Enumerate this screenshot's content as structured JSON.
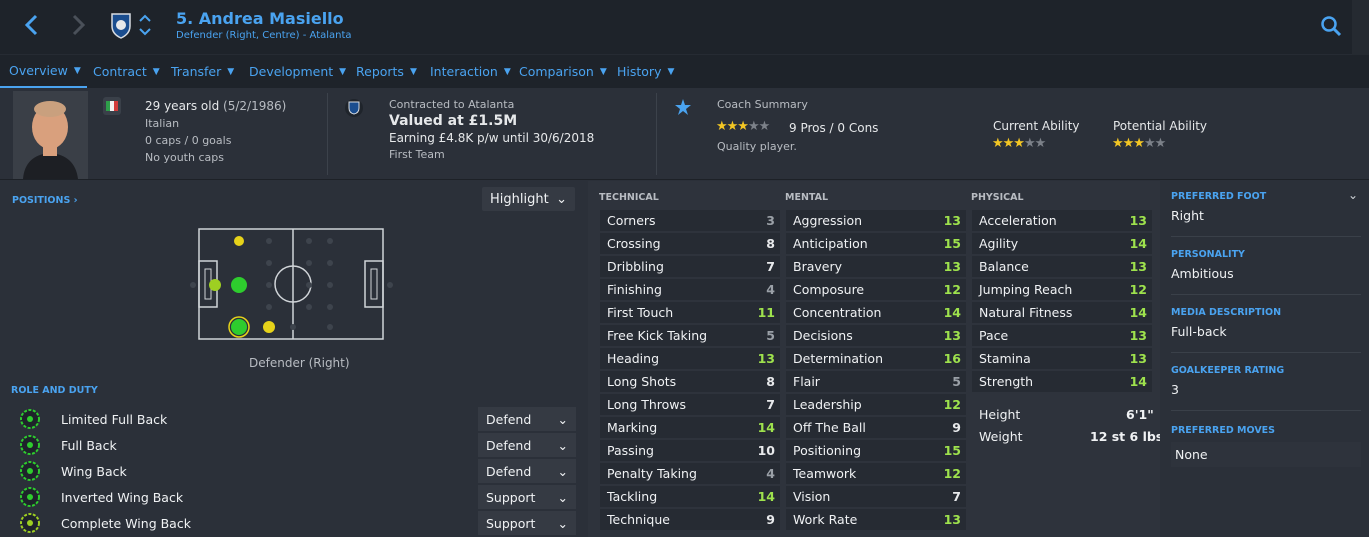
{
  "header": {
    "title": "5. Andrea Masiello",
    "subtitle": "Defender (Right, Centre) - Atalanta"
  },
  "tabs": [
    "Overview",
    "Contract",
    "Transfer",
    "Development",
    "Reports",
    "Interaction",
    "Comparison",
    "History"
  ],
  "summary": {
    "age": "29 years old",
    "dob": "(5/2/1986)",
    "nationality": "Italian",
    "caps": "0 caps / 0 goals",
    "youth": "No youth caps",
    "contracted": "Contracted to Atalanta",
    "value": "Valued at £1.5M",
    "earning": "Earning £4.8K p/w until 30/6/2018",
    "squad": "First Team",
    "coach_title": "Coach Summary",
    "pros_cons": "9 Pros / 0 Cons",
    "quality": "Quality player.",
    "coach_stars": 3,
    "current_ability_label": "Current Ability",
    "potential_ability_label": "Potential Ability",
    "current_stars": 3,
    "potential_stars": 3
  },
  "positions": {
    "label": "POSITIONS",
    "highlight": "Highlight",
    "caption": "Defender (Right)"
  },
  "role_duty": {
    "label": "ROLE AND DUTY",
    "roles": [
      {
        "name": "Limited Full Back",
        "duty": "Defend"
      },
      {
        "name": "Full Back",
        "duty": "Defend"
      },
      {
        "name": "Wing Back",
        "duty": "Defend"
      },
      {
        "name": "Inverted Wing Back",
        "duty": "Support"
      },
      {
        "name": "Complete Wing Back",
        "duty": "Support"
      }
    ]
  },
  "attributes": {
    "technical_label": "TECHNICAL",
    "mental_label": "MENTAL",
    "physical_label": "PHYSICAL",
    "technical": [
      {
        "name": "Corners",
        "value": "3"
      },
      {
        "name": "Crossing",
        "value": "8"
      },
      {
        "name": "Dribbling",
        "value": "7"
      },
      {
        "name": "Finishing",
        "value": "4"
      },
      {
        "name": "First Touch",
        "value": "11"
      },
      {
        "name": "Free Kick Taking",
        "value": "5"
      },
      {
        "name": "Heading",
        "value": "13"
      },
      {
        "name": "Long Shots",
        "value": "8"
      },
      {
        "name": "Long Throws",
        "value": "7"
      },
      {
        "name": "Marking",
        "value": "14"
      },
      {
        "name": "Passing",
        "value": "10"
      },
      {
        "name": "Penalty Taking",
        "value": "4"
      },
      {
        "name": "Tackling",
        "value": "14"
      },
      {
        "name": "Technique",
        "value": "9"
      }
    ],
    "mental": [
      {
        "name": "Aggression",
        "value": "13"
      },
      {
        "name": "Anticipation",
        "value": "15"
      },
      {
        "name": "Bravery",
        "value": "13"
      },
      {
        "name": "Composure",
        "value": "12"
      },
      {
        "name": "Concentration",
        "value": "14"
      },
      {
        "name": "Decisions",
        "value": "13"
      },
      {
        "name": "Determination",
        "value": "16"
      },
      {
        "name": "Flair",
        "value": "5"
      },
      {
        "name": "Leadership",
        "value": "12"
      },
      {
        "name": "Off The Ball",
        "value": "9"
      },
      {
        "name": "Positioning",
        "value": "15"
      },
      {
        "name": "Teamwork",
        "value": "12"
      },
      {
        "name": "Vision",
        "value": "7"
      },
      {
        "name": "Work Rate",
        "value": "13"
      }
    ],
    "physical": [
      {
        "name": "Acceleration",
        "value": "13"
      },
      {
        "name": "Agility",
        "value": "14"
      },
      {
        "name": "Balance",
        "value": "13"
      },
      {
        "name": "Jumping Reach",
        "value": "12"
      },
      {
        "name": "Natural Fitness",
        "value": "14"
      },
      {
        "name": "Pace",
        "value": "13"
      },
      {
        "name": "Stamina",
        "value": "13"
      },
      {
        "name": "Strength",
        "value": "14"
      }
    ],
    "height_label": "Height",
    "height": "6'1\"",
    "weight_label": "Weight",
    "weight": "12 st 6 lbs"
  },
  "info": {
    "foot_label": "PREFERRED FOOT",
    "foot": "Right",
    "personality_label": "PERSONALITY",
    "personality": "Ambitious",
    "media_label": "MEDIA DESCRIPTION",
    "media": "Full-back",
    "gk_label": "GOALKEEPER RATING",
    "gk": "3",
    "moves_label": "PREFERRED MOVES",
    "moves": "None"
  },
  "colors": {
    "accent": "#4aa3f0",
    "star": "#f3c624",
    "good": "#9ee24d"
  }
}
